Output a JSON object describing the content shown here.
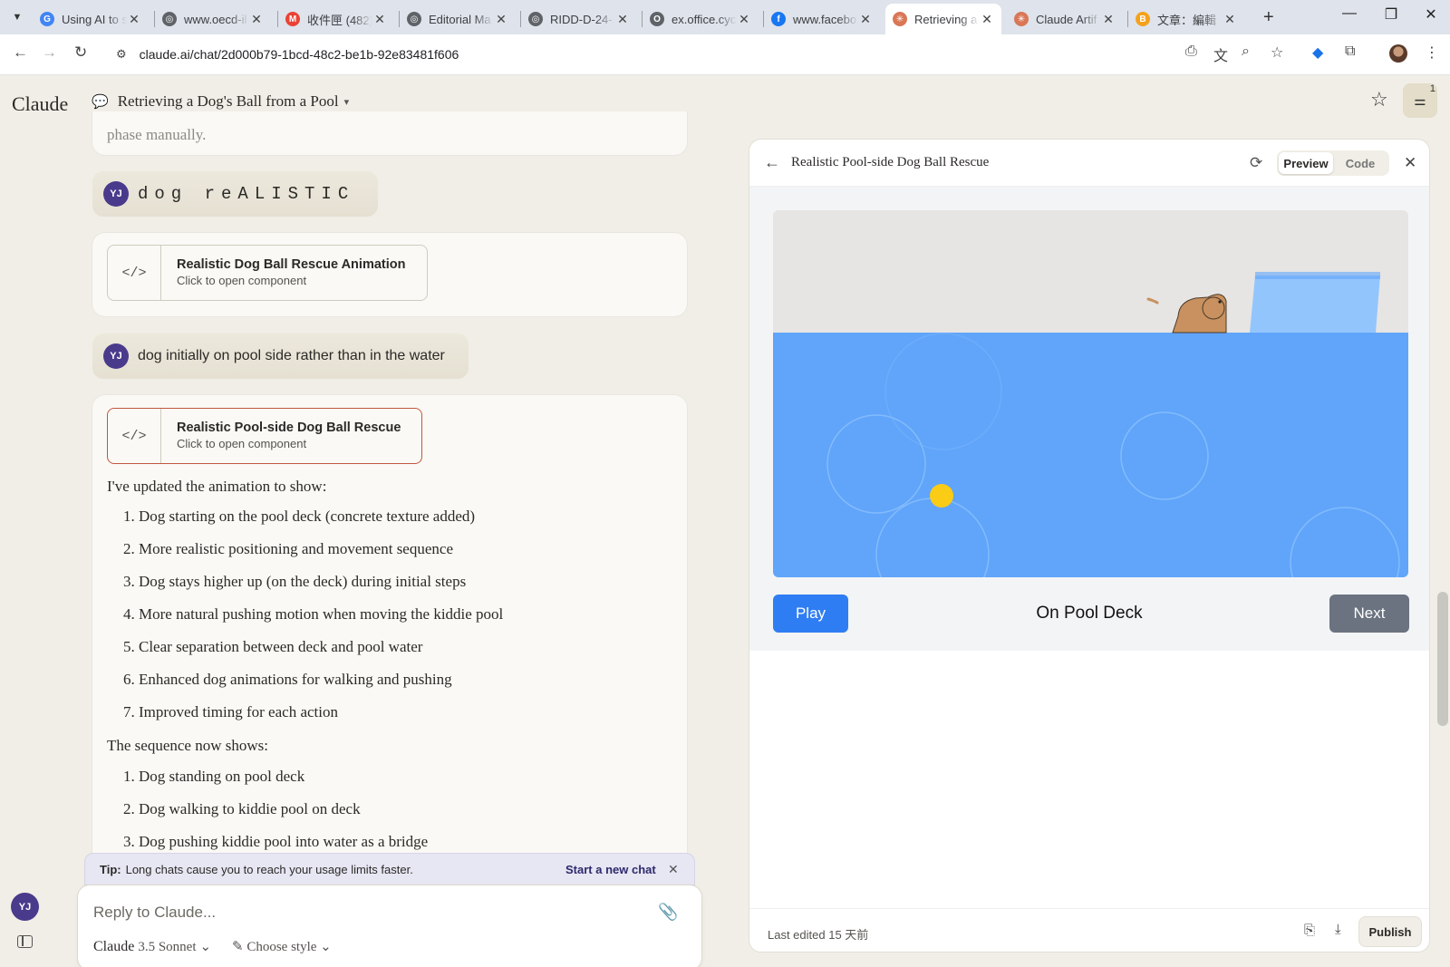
{
  "browser": {
    "tabs": [
      {
        "title": "Using AI to s",
        "fav_color": "#4285f4",
        "fav_glyph": "G"
      },
      {
        "title": "www.oecd-il",
        "fav_color": "#5f6368",
        "fav_glyph": "◎"
      },
      {
        "title": "收件匣 (482)",
        "fav_color": "#ea4335",
        "fav_glyph": "M"
      },
      {
        "title": "Editorial Ma",
        "fav_color": "#5f6368",
        "fav_glyph": "◎"
      },
      {
        "title": "RIDD-D-24-",
        "fav_color": "#5f6368",
        "fav_glyph": "◎"
      },
      {
        "title": "ex.office.cyc",
        "fav_color": "#5f6368",
        "fav_glyph": "O"
      },
      {
        "title": "www.facebo",
        "fav_color": "#1877f2",
        "fav_glyph": "f"
      },
      {
        "title": "Retrieving a",
        "fav_color": "#d97757",
        "fav_glyph": "✳",
        "active": true
      },
      {
        "title": "Claude Artif",
        "fav_color": "#d97757",
        "fav_glyph": "✳"
      },
      {
        "title": "文章：編輯",
        "fav_color": "#f4a21c",
        "fav_glyph": "B"
      }
    ],
    "url": "claude.ai/chat/2d000b79-1bcd-48c2-be1b-92e83481f606"
  },
  "header": {
    "logo": "Claude",
    "chat_title": "Retrieving a Dog's Ball from a Pool",
    "notification_count": "1"
  },
  "chat": {
    "previous_tail": "phase manually.",
    "user_initials": "YJ",
    "msg1": "dog reALISTIC",
    "artifact1": {
      "name": "Realistic Dog Ball Rescue Animation",
      "sub": "Click to open component"
    },
    "msg2": "dog initially on pool side rather than in the water",
    "artifact2": {
      "name": "Realistic Pool-side Dog Ball Rescue",
      "sub": "Click to open component"
    },
    "reply_intro": "I've updated the animation to show:",
    "updates": [
      "1. Dog starting on the pool deck (concrete texture added)",
      "2. More realistic positioning and movement sequence",
      "3. Dog stays higher up (on the deck) during initial steps",
      "4. More natural pushing motion when moving the kiddie pool",
      "5. Clear separation between deck and pool water",
      "6. Enhanced dog animations for walking and pushing",
      "7. Improved timing for each action"
    ],
    "sequence_intro": "The sequence now shows:",
    "sequence": [
      "1. Dog standing on pool deck",
      "2. Dog walking to kiddie pool on deck",
      "3. Dog pushing kiddie pool into water as a bridge"
    ]
  },
  "tip": {
    "label": "Tip:",
    "text": "Long chats cause you to reach your usage limits faster.",
    "action": "Start a new chat"
  },
  "composer": {
    "placeholder": "Reply to Claude...",
    "model": "Claude",
    "model_version": "3.5 Sonnet",
    "style": "Choose style"
  },
  "panel": {
    "title": "Realistic Pool-side Dog Ball Rescue",
    "tab_preview": "Preview",
    "tab_code": "Code",
    "play_label": "Play",
    "step_label": "On Pool Deck",
    "next_label": "Next",
    "last_edited": "Last edited 15 天前",
    "publish_label": "Publish"
  },
  "colors": {
    "water": "#60a5fa",
    "deck": "#e6e5e3",
    "ball": "#facc15",
    "dog": "#c8915f",
    "kiddie_pool": "#93c5fd",
    "accent": "#c0573f"
  }
}
